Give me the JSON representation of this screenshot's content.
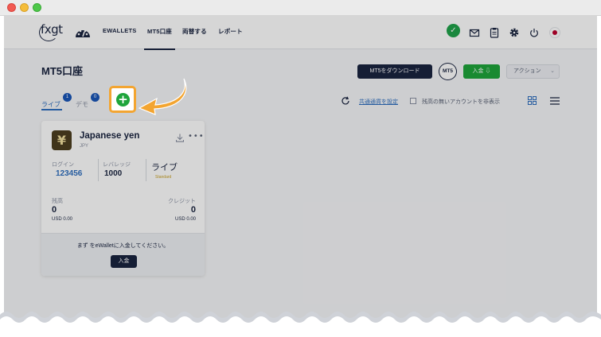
{
  "nav": {
    "logo": "fxgt",
    "items": [
      {
        "label": "EWALLETS"
      },
      {
        "label": "MT5口座"
      },
      {
        "label": "両替する"
      },
      {
        "label": "レポート"
      }
    ]
  },
  "page": {
    "title": "MT5口座"
  },
  "actions": {
    "download": "MT5をダウンロード",
    "mt5": "MT5",
    "deposit": "入金 ⇩",
    "action": "アクション"
  },
  "tabs": {
    "live": "ライブ",
    "live_count": "1",
    "demo": "デモ",
    "demo_count": "0"
  },
  "filters": {
    "currency_link": "共通通貨を設定",
    "hide_label": "残高の無いアカウントを非表示"
  },
  "account": {
    "icon": "¥",
    "name": "Japanese yen",
    "code": "JPY",
    "login_label": "ログイン",
    "login": "123456",
    "leverage_label": "レバレッジ",
    "leverage": "1000",
    "type": "ライブ",
    "type_sub": "Standard",
    "balance_label": "残高",
    "balance": "0",
    "balance_usd": "USD 0.00",
    "credit_label": "クレジット",
    "credit": "0",
    "credit_usd": "USD 0.00",
    "footer_message": "まず をeWalletに入金してください。",
    "footer_button": "入金"
  },
  "colors": {
    "navy": "#1a2440",
    "green": "#1ea53b",
    "blue_link": "#2f6fbf",
    "highlight": "#f3a531"
  },
  "icons": [
    "dashboard-icon",
    "check-icon",
    "mail-icon",
    "clipboard-icon",
    "gear-icon",
    "power-icon",
    "flag-icon",
    "refresh-icon",
    "grid-view-icon",
    "list-view-icon",
    "download-icon",
    "more-icon",
    "plus-icon",
    "arrow-icon"
  ]
}
